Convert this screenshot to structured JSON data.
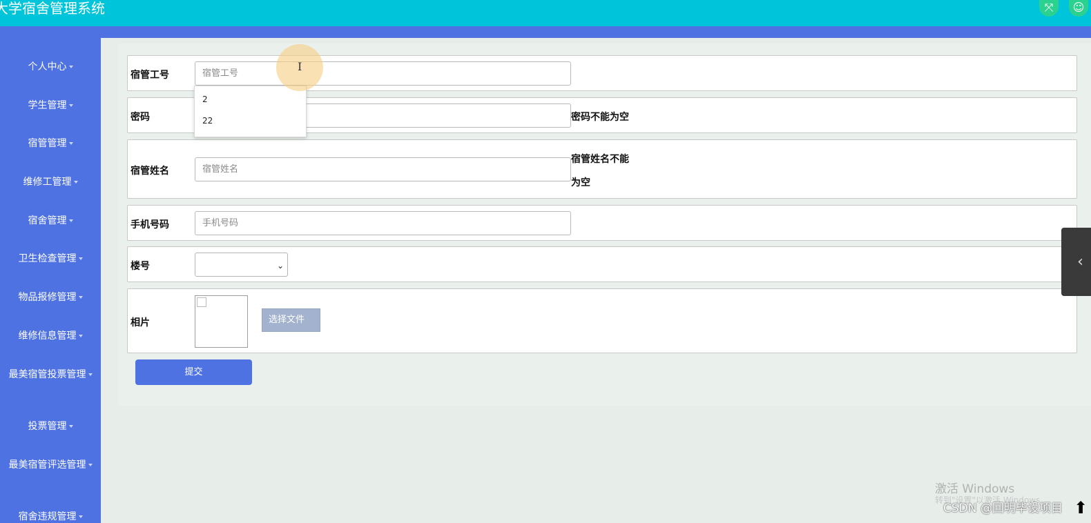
{
  "header": {
    "title": "大学宿舍管理系统",
    "icons": [
      "fullscreen-icon",
      "user-icon"
    ]
  },
  "sidebar": {
    "items": [
      {
        "label": "个人中心"
      },
      {
        "label": "学生管理"
      },
      {
        "label": "宿管管理"
      },
      {
        "label": "维修工管理"
      },
      {
        "label": "宿舍管理"
      },
      {
        "label": "卫生检查管理"
      },
      {
        "label": "物品报修管理"
      },
      {
        "label": "维修信息管理"
      },
      {
        "label": "最美宿管投票管理"
      },
      {
        "label": "投票管理"
      },
      {
        "label": "最美宿管评选管理"
      },
      {
        "label": "宿舍违规管理"
      }
    ]
  },
  "form": {
    "fields": {
      "staff_id": {
        "label": "宿管工号",
        "placeholder": "宿管工号",
        "value": ""
      },
      "password": {
        "label": "密码",
        "error": "密码不能为空"
      },
      "name": {
        "label": "宿管姓名",
        "placeholder": "宿管姓名",
        "error_line1": "宿管姓名不能",
        "error_line2": "为空"
      },
      "phone": {
        "label": "手机号码",
        "placeholder": "手机号码"
      },
      "building": {
        "label": "楼号",
        "value": ""
      },
      "photo": {
        "label": "相片",
        "choose_file": "选择文件"
      }
    },
    "autocomplete": [
      "2",
      "22"
    ],
    "submit_label": "提交"
  },
  "overlay": {
    "watermark_line1": "激活 Windows",
    "watermark_line2": "转到\"设置\"以激活 Windows。",
    "credit": "CSDN @回明毕设项目"
  }
}
